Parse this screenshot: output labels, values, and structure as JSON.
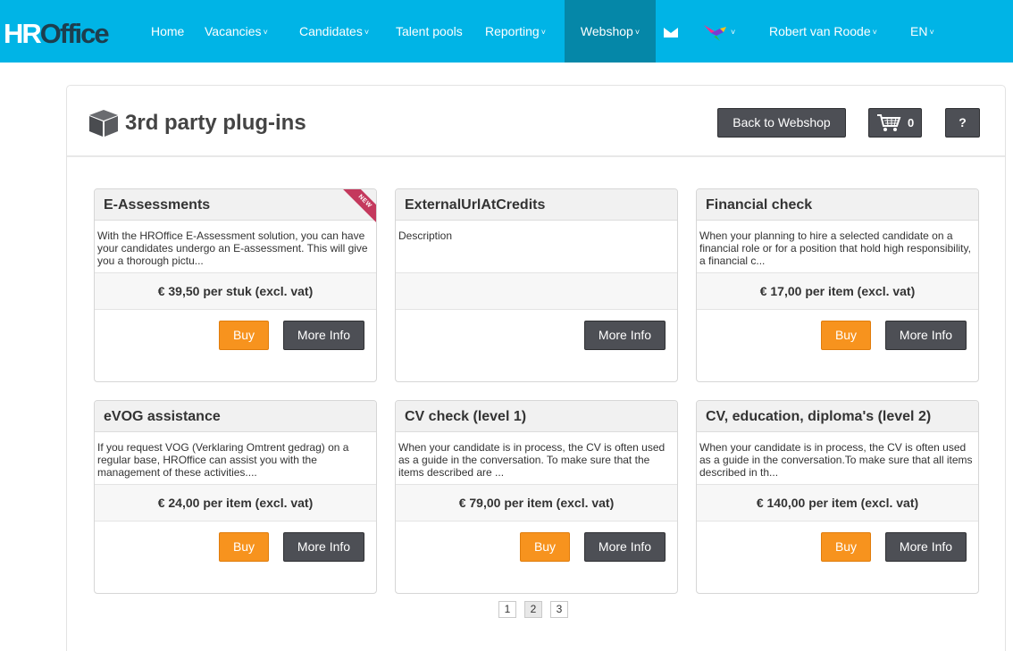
{
  "nav": {
    "logo_hr": "HR",
    "logo_office": "Office",
    "items": [
      {
        "label": "Home",
        "has_caret": false
      },
      {
        "label": "Vacancies",
        "has_caret": true
      },
      {
        "label": "Candidates",
        "has_caret": true
      },
      {
        "label": "Talent pools",
        "has_caret": false
      },
      {
        "label": "Reporting",
        "has_caret": true
      },
      {
        "label": "Webshop",
        "has_caret": true,
        "active": true
      },
      {
        "icon": "mail-icon"
      },
      {
        "icon": "hummingbird-icon",
        "has_caret": true
      },
      {
        "label": "Robert van Roode",
        "has_caret": true
      },
      {
        "label": "EN",
        "has_caret": true
      }
    ],
    "caret": "˅"
  },
  "header": {
    "title": "3rd party plug-ins",
    "back_label": "Back to Webshop",
    "cart_count": "0",
    "help_label": "?"
  },
  "cards": [
    {
      "title": "E-Assessments",
      "badge": "NEW",
      "description": "With the HROffice E-Assessment solution, you can have your candidates undergo an E-assessment. This will give you a thorough pictu...",
      "price": "€ 39,50 per stuk (excl. vat)",
      "buy_label": "Buy",
      "more_label": "More Info"
    },
    {
      "title": "ExternalUrlAtCredits",
      "description": "Description",
      "price": "",
      "more_label": "More Info"
    },
    {
      "title": "Financial check",
      "description": "When your planning to hire a selected candidate on a financial role or for a position that hold high responsibility, a financial c...",
      "price": "€ 17,00 per item (excl. vat)",
      "buy_label": "Buy",
      "more_label": "More Info"
    },
    {
      "title": "eVOG assistance",
      "description": "If you request VOG (Verklaring Omtrent gedrag) on a regular base, HROffice can assist you with the management of these activities....",
      "price": "€ 24,00 per item (excl. vat)",
      "buy_label": "Buy",
      "more_label": "More Info"
    },
    {
      "title": "CV check (level 1)",
      "description": "When your candidate is in process, the CV is often used as a guide in the conversation. To make sure that the items described are ...",
      "price": "€ 79,00 per item (excl. vat)",
      "buy_label": "Buy",
      "more_label": "More Info"
    },
    {
      "title": "CV, education, diploma's (level 2)",
      "description": "When your candidate is in process, the CV is often used as a guide in the conversation.To make sure that all items described in th...",
      "price": "€ 140,00 per item (excl. vat)",
      "buy_label": "Buy",
      "more_label": "More Info"
    }
  ],
  "pagination": {
    "pages": [
      "1",
      "2",
      "3"
    ],
    "current": "2"
  },
  "colors": {
    "navbar": "#00b4e6",
    "nav_active": "#0587a8",
    "buy_button": "#f7931e",
    "dark_button": "#4d4f55",
    "new_ribbon": "#c4395d"
  }
}
